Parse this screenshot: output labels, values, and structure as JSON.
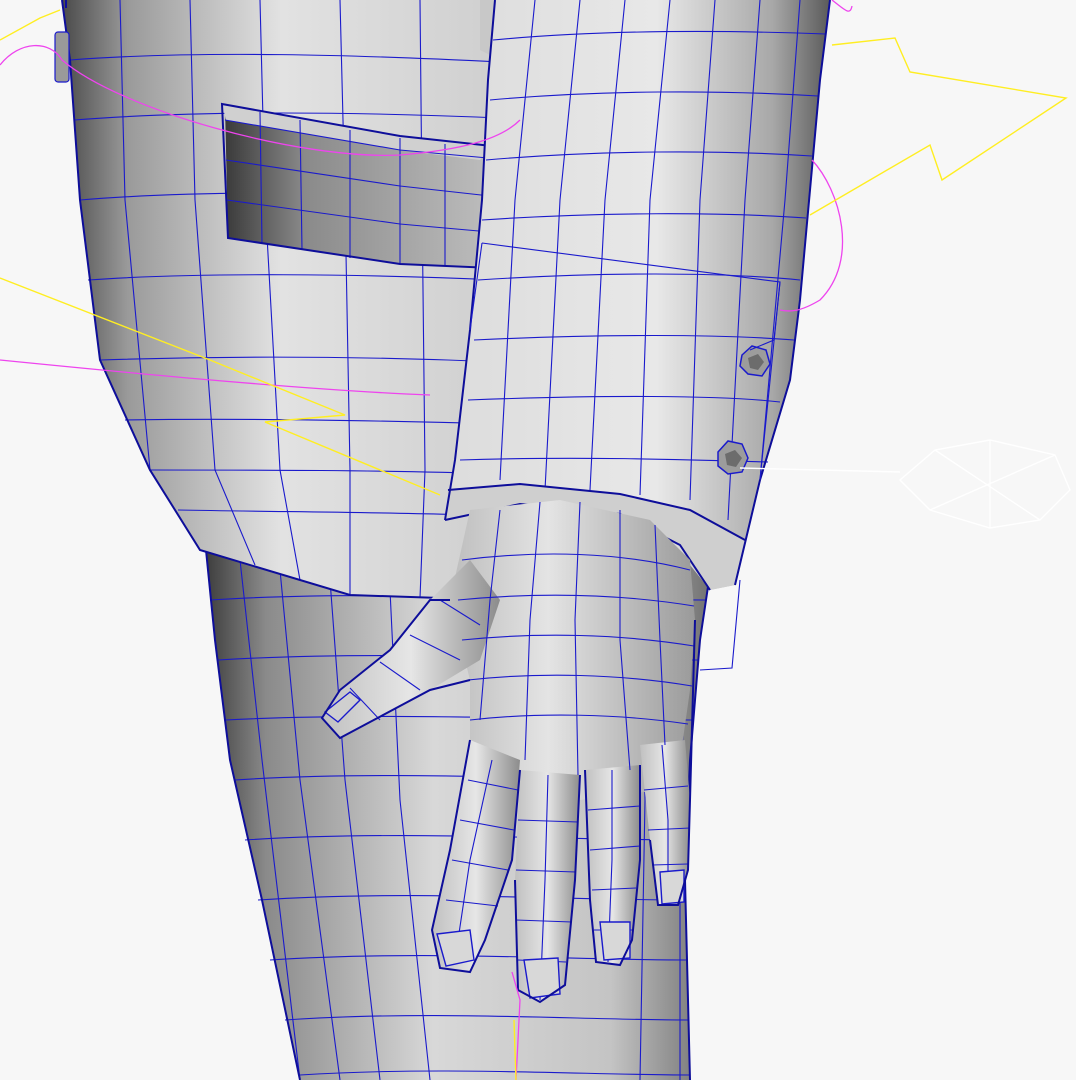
{
  "viewport": {
    "description": "",
    "background": "#f7f7f7",
    "colors": {
      "wireframe": "#1a1acc",
      "mesh_light": "#e6e6e6",
      "mesh_mid": "#b4b4b4",
      "mesh_dark": "#4a4a4a",
      "ik_curve": "#ee44ee",
      "control": "#ffee22",
      "locator": "#ffffff"
    },
    "objects": [
      {
        "name": "torso-jacket-mesh"
      },
      {
        "name": "jacket-pocket-mesh"
      },
      {
        "name": "sleeve-mesh"
      },
      {
        "name": "cuff-buttons"
      },
      {
        "name": "hand-mesh"
      },
      {
        "name": "leg-mesh"
      },
      {
        "name": "magenta-control-curves"
      },
      {
        "name": "yellow-control-curves"
      },
      {
        "name": "white-locator"
      }
    ]
  }
}
